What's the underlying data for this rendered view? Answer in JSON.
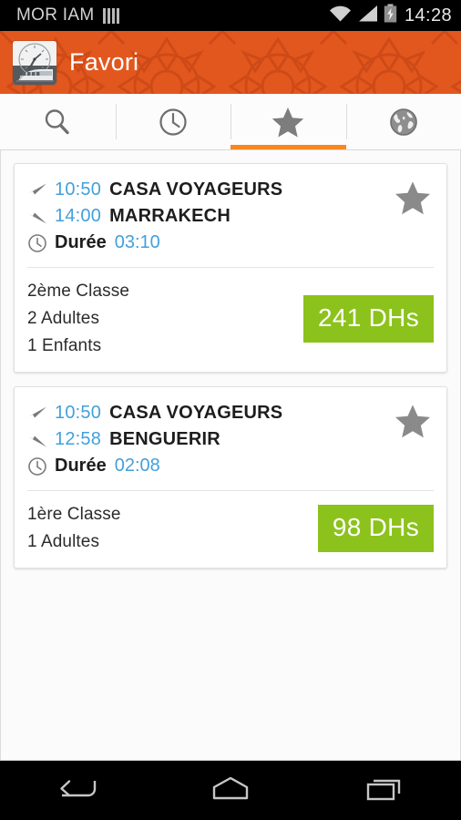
{
  "status_bar": {
    "carrier": "MOR IAM",
    "time": "14:28",
    "icons": [
      "sim-signal-icon",
      "wifi-icon",
      "cellular-signal-icon",
      "battery-charging-icon"
    ]
  },
  "action_bar": {
    "title": "Favori",
    "app_icon": "train-clock-app-icon",
    "background_color": "#E2571E"
  },
  "tabs": [
    {
      "name": "search",
      "icon": "search-icon",
      "active": false
    },
    {
      "name": "history",
      "icon": "clock-icon",
      "active": false
    },
    {
      "name": "favorites",
      "icon": "star-icon",
      "active": true
    },
    {
      "name": "world",
      "icon": "globe-icon",
      "active": false
    }
  ],
  "theme": {
    "accent_orange": "#F6881F",
    "header_orange": "#E2571E",
    "time_blue": "#43A0DB",
    "price_green": "#8CC21C",
    "star_gray": "#8a8a8a"
  },
  "favorites": [
    {
      "depart_time": "10:50",
      "depart_station": "CASA VOYAGEURS",
      "arrive_time": "14:00",
      "arrive_station": "MARRAKECH",
      "duration_label": "Durée",
      "duration_value": "03:10",
      "passengers": [
        "2ème Classe",
        "2 Adultes",
        "1 Enfants"
      ],
      "price": "241 DHs",
      "starred": true
    },
    {
      "depart_time": "10:50",
      "depart_station": "CASA VOYAGEURS",
      "arrive_time": "12:58",
      "arrive_station": "BENGUERIR",
      "duration_label": "Durée",
      "duration_value": "02:08",
      "passengers": [
        "1ère Classe",
        "1 Adultes"
      ],
      "price": "98 DHs",
      "starred": true
    }
  ],
  "nav_bar": {
    "buttons": [
      {
        "name": "back",
        "icon": "back-arrow-icon"
      },
      {
        "name": "home",
        "icon": "home-icon"
      },
      {
        "name": "recents",
        "icon": "recents-icon"
      }
    ]
  }
}
